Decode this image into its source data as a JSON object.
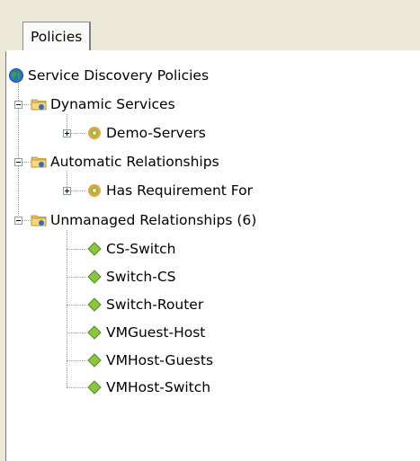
{
  "tabs": [
    {
      "label": "Policies"
    }
  ],
  "tree": {
    "root": {
      "label": "Service Discovery Policies",
      "icon": "globe-icon"
    },
    "groups": [
      {
        "label": "Dynamic Services",
        "icon": "folder-icon",
        "expanded": true,
        "children": [
          {
            "label": "Demo-Servers",
            "icon": "gear-icon",
            "expandable": true
          }
        ]
      },
      {
        "label": "Automatic Relationships",
        "icon": "folder-icon",
        "expanded": true,
        "children": [
          {
            "label": "Has Requirement For",
            "icon": "gear-icon",
            "expandable": true
          }
        ]
      },
      {
        "label": "Unmanaged Relationships (6)",
        "icon": "folder-icon",
        "expanded": true,
        "children": [
          {
            "label": "CS-Switch",
            "icon": "diamond-icon"
          },
          {
            "label": "Switch-CS",
            "icon": "diamond-icon"
          },
          {
            "label": "Switch-Router",
            "icon": "diamond-icon"
          },
          {
            "label": "VMGuest-Host",
            "icon": "diamond-icon"
          },
          {
            "label": "VMHost-Guests",
            "icon": "diamond-icon"
          },
          {
            "label": "VMHost-Switch",
            "icon": "diamond-icon"
          }
        ]
      }
    ]
  }
}
